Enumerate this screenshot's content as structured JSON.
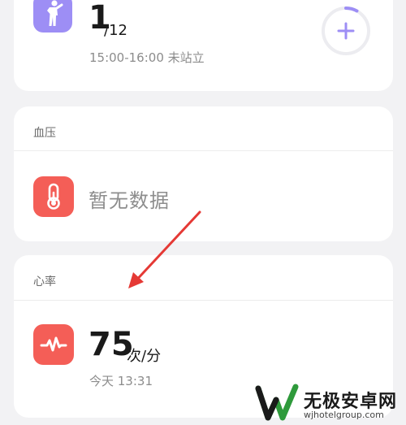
{
  "stand": {
    "value": "1",
    "total": "/12",
    "time_status": "15:00-16:00 未站立",
    "icon": "standing-person-icon",
    "add_icon": "plus-icon",
    "progress_fraction": 0.08
  },
  "blood_pressure": {
    "title": "血压",
    "empty_text": "暂无数据",
    "icon": "thermometer-icon"
  },
  "heart_rate": {
    "title": "心率",
    "value": "75",
    "unit": "次/分",
    "time": "今天 13:31",
    "icon": "heartbeat-icon"
  },
  "watermark": {
    "title": "无极安卓网",
    "url": "wjhotelgroup.com"
  },
  "colors": {
    "accent_purple": "#9d8ef5",
    "accent_red": "#f45e57",
    "arrow_red": "#e53935",
    "background": "#f2f2f4",
    "card": "#ffffff"
  }
}
